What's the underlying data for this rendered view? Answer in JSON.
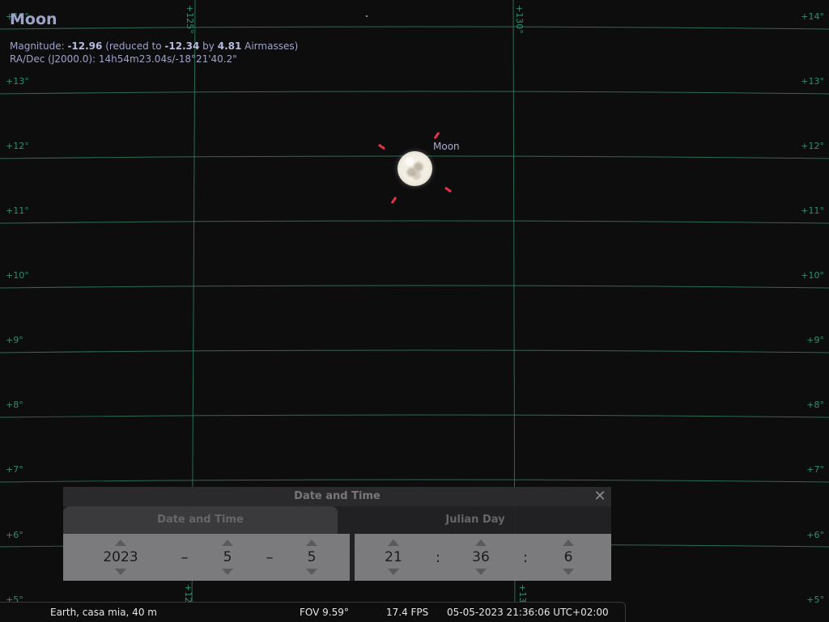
{
  "object": {
    "name": "Moon",
    "magnitude_label": "Magnitude: ",
    "magnitude": "-12.96",
    "reduced_pre": " (reduced to ",
    "reduced_value": "-12.34",
    "by_word": " by ",
    "airmasses_value": "4.81",
    "airmasses_label": " Airmasses)",
    "radec": "RA/Dec (J2000.0): 14h54m23.04s/-18°21'40.2\"",
    "sky_label": "Moon"
  },
  "grid": {
    "dec_labels": [
      "+14°",
      "+13°",
      "+12°",
      "+11°",
      "+10°",
      "+9°",
      "+8°",
      "+7°",
      "+6°",
      "+5°"
    ],
    "ra_labels": [
      "+125°",
      "+130°"
    ]
  },
  "dialog": {
    "title": "Date and Time",
    "close_symbol": "✕",
    "tabs": [
      "Date and Time",
      "Julian Day"
    ],
    "date": {
      "year": "2023",
      "month": "5",
      "day": "5",
      "separator": "–"
    },
    "time": {
      "hour": "21",
      "minute": "36",
      "second": "6",
      "separator": ":"
    }
  },
  "statusbar": {
    "location": "Earth, casa mia, 40 m",
    "fov": "FOV 9.59°",
    "fps": "17.4 FPS",
    "datetime": "05-05-2023 21:36:06 UTC+02:00"
  },
  "colors": {
    "background": "#0d0d0e",
    "grid": "#2e7d63",
    "info_text": "#9ea3c8",
    "pointer": "#e23645"
  }
}
